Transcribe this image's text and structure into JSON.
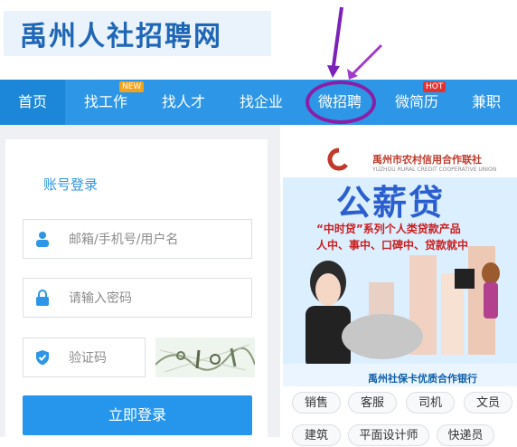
{
  "site": {
    "logo_text": "禹州人社招聘网"
  },
  "nav": {
    "items": [
      {
        "label": "首页"
      },
      {
        "label": "找工作",
        "badge": "NEW"
      },
      {
        "label": "找人才"
      },
      {
        "label": "找企业"
      },
      {
        "label": "微招聘"
      },
      {
        "label": "微简历",
        "badge": "HOT"
      },
      {
        "label": "兼职"
      }
    ]
  },
  "login": {
    "title": "账号登录",
    "username_placeholder": "邮箱/手机号/用户名",
    "password_placeholder": "请输入密码",
    "captcha_placeholder": "验证码",
    "submit_label": "立即登录"
  },
  "ad": {
    "bank_name": "禹州市农村信用合作联社",
    "bank_name_en": "YUZHOU RURAL CREDIT COOPERATIVE UNION",
    "title": "公薪贷",
    "line1": "“中时贷”系列个人类贷款产品",
    "line2": "人中、事中、口碑中、贷款就中",
    "footer": "禹州社保卡优质合作银行"
  },
  "tags": [
    "销售",
    "客服",
    "司机",
    "文员",
    "建筑",
    "平面设计师",
    "快递员"
  ],
  "colors": {
    "nav_bg": "#2d96e6",
    "accent": "#2596ec",
    "highlight": "#8a1fa6"
  }
}
